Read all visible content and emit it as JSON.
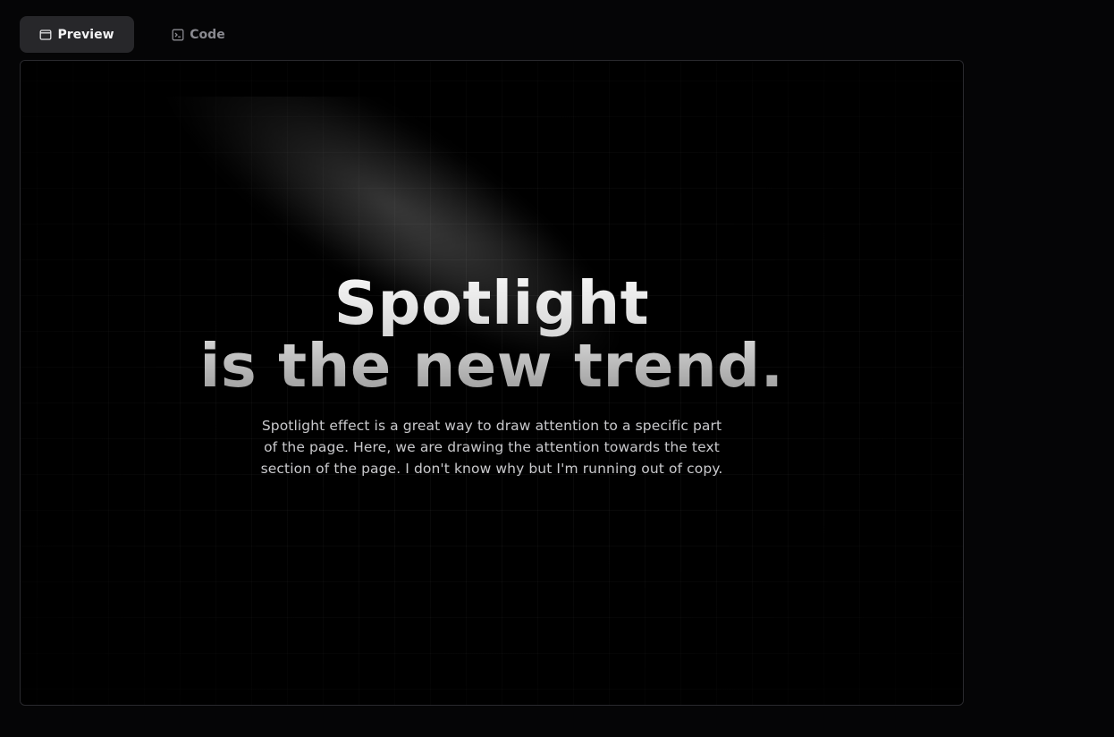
{
  "tabs": [
    {
      "label": "Preview",
      "icon": "window-icon",
      "active": true
    },
    {
      "label": "Code",
      "icon": "terminal-icon",
      "active": false
    }
  ],
  "hero": {
    "title_line1": "Spotlight",
    "title_line2": "is the new trend.",
    "description": "Spotlight effect is a great way to draw attention to a specific part of the page. Here, we are drawing the attention towards the text section of the page. I don't know why but I'm running out of copy."
  },
  "colors": {
    "page_background": "#050506",
    "active_tab_background": "#27272a",
    "preview_background": "#000000",
    "border": "#2a2a2e"
  }
}
